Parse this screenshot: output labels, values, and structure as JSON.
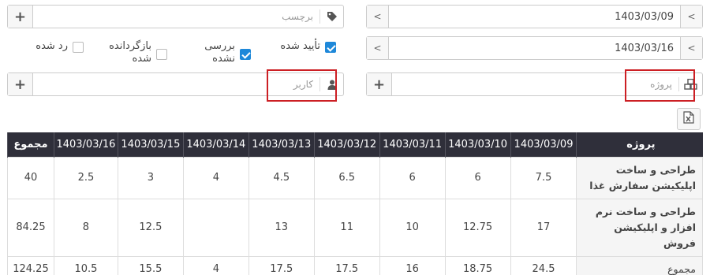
{
  "dates": {
    "from": "1403/03/09",
    "to": "1403/03/16",
    "prev_symbol": "<",
    "next_symbol": "<"
  },
  "tag": {
    "placeholder": "برچسب",
    "add_symbol": "+"
  },
  "user": {
    "placeholder": "کاربر",
    "add_symbol": "+"
  },
  "project": {
    "placeholder": "پروژه",
    "add_symbol": "+"
  },
  "statuses": [
    {
      "label": "تأیید شده",
      "checked": true
    },
    {
      "label": "بررسی نشده",
      "checked": true
    },
    {
      "label": "بازگردانده شده",
      "checked": false
    },
    {
      "label": "رد شده",
      "checked": false
    }
  ],
  "table": {
    "headers": [
      "پروژه",
      "1403/03/09",
      "1403/03/10",
      "1403/03/11",
      "1403/03/12",
      "1403/03/13",
      "1403/03/14",
      "1403/03/15",
      "1403/03/16",
      "مجموع"
    ],
    "rows": [
      {
        "project": "طراحی و ساخت اپلیکیشن سفارش غذا",
        "values": [
          "7.5",
          "6",
          "6",
          "6.5",
          "4.5",
          "4",
          "3",
          "2.5",
          "40"
        ]
      },
      {
        "project": "طراحی و ساخت نرم افزار و اپلیکیشن فروش",
        "values": [
          "17",
          "12.75",
          "10",
          "11",
          "13",
          "",
          "12.5",
          "8",
          "84.25"
        ]
      },
      {
        "project": "مجموع",
        "values": [
          "24.5",
          "18.75",
          "16",
          "17.5",
          "17.5",
          "4",
          "15.5",
          "10.5",
          "124.25"
        ]
      }
    ]
  },
  "colors": {
    "header_bg": "#2f2f3a",
    "highlight": "#cc1f24",
    "checkbox_on": "#1e88d9"
  },
  "icons": [
    "tag-icon",
    "user-icon",
    "cubes-icon",
    "excel-icon",
    "plus-icon",
    "chevron-left-icon"
  ]
}
